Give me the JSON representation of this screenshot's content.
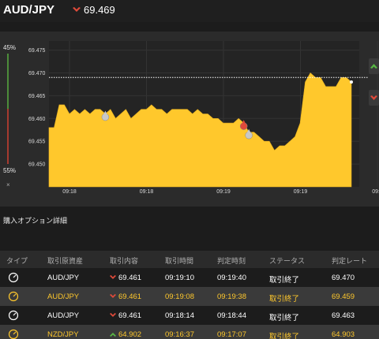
{
  "header": {
    "pair": "AUD/JPY",
    "price": "69.469",
    "price_direction_icon": "down-arrow-icon",
    "down_color": "#e04a3a",
    "up_color": "#58b744"
  },
  "side_gauge": {
    "top_label": "45%",
    "bottom_label": "55%",
    "close_label": "×"
  },
  "chart_data": {
    "type": "area",
    "color": "#ffc82c",
    "x_ticks": [
      "09:18",
      "09:18",
      "09:19",
      "09:19",
      "09:1"
    ],
    "y_ticks": [
      "69.475",
      "69.470",
      "69.465",
      "69.460",
      "69.455",
      "69.450"
    ],
    "ylim": [
      69.445,
      69.477
    ],
    "reference_line": 69.469,
    "series": [
      69.458,
      69.458,
      69.463,
      69.463,
      69.461,
      69.462,
      69.461,
      69.462,
      69.461,
      69.462,
      69.462,
      69.461,
      69.462,
      69.46,
      69.461,
      69.462,
      69.46,
      69.461,
      69.462,
      69.462,
      69.463,
      69.462,
      69.462,
      69.461,
      69.462,
      69.462,
      69.462,
      69.462,
      69.461,
      69.462,
      69.461,
      69.461,
      69.46,
      69.46,
      69.459,
      69.459,
      69.459,
      69.46,
      69.459,
      69.457,
      69.457,
      69.456,
      69.455,
      69.455,
      69.453,
      69.454,
      69.454,
      69.455,
      69.456,
      69.459,
      69.468,
      69.47,
      69.469,
      69.469,
      69.467,
      69.467,
      69.467,
      69.469,
      69.469,
      69.468
    ],
    "markers": [
      {
        "index": 11,
        "direction": "down"
      },
      {
        "index": 38,
        "direction": "up"
      },
      {
        "index": 39,
        "direction": "down"
      }
    ],
    "grid": true
  },
  "purchase_section": {
    "title": "購入オプション詳細"
  },
  "table": {
    "headers": [
      "タイプ",
      "取引原資産",
      "取引内容",
      "取引時間",
      "判定時刻",
      "ステータス",
      "判定レート"
    ],
    "rows": [
      {
        "asset": "AUD/JPY",
        "direction": "down",
        "rate": "69.461",
        "trade_time": "09:19:10",
        "judge_time": "09:19:40",
        "status": "取引終了",
        "judge_rate": "69.470",
        "highlight": false
      },
      {
        "asset": "AUD/JPY",
        "direction": "down",
        "rate": "69.461",
        "trade_time": "09:19:08",
        "judge_time": "09:19:38",
        "status": "取引終了",
        "judge_rate": "69.459",
        "highlight": true
      },
      {
        "asset": "AUD/JPY",
        "direction": "down",
        "rate": "69.461",
        "trade_time": "09:18:14",
        "judge_time": "09:18:44",
        "status": "取引終了",
        "judge_rate": "69.463",
        "highlight": false
      },
      {
        "asset": "NZD/JPY",
        "direction": "up",
        "rate": "64.902",
        "trade_time": "09:16:37",
        "judge_time": "09:17:07",
        "status": "取引終了",
        "judge_rate": "64.903",
        "highlight": true
      }
    ]
  }
}
